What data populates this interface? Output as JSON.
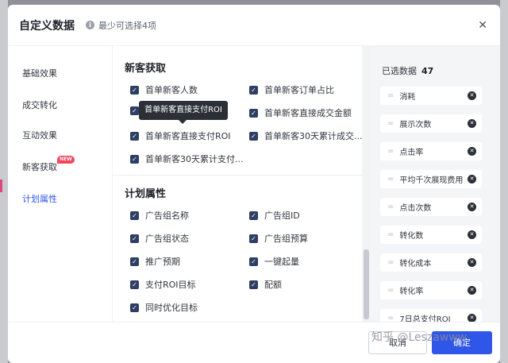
{
  "modal": {
    "title": "自定义数据",
    "hint": "最少可选择4项"
  },
  "sidebar": {
    "items": [
      {
        "label": "基础效果"
      },
      {
        "label": "成交转化"
      },
      {
        "label": "互动效果"
      },
      {
        "label": "新客获取",
        "badge": "NEW"
      },
      {
        "label": "计划属性"
      }
    ],
    "active": "计划属性"
  },
  "sections": [
    {
      "title": "新客获取",
      "options": [
        {
          "label": "首单新客人数",
          "checked": true
        },
        {
          "label": "首单新客订单占比",
          "checked": true
        },
        {
          "label": "",
          "checked": true
        },
        {
          "label": "首单新客直接成交金额",
          "checked": true
        },
        {
          "label": "首单新客直接支付ROI",
          "checked": true
        },
        {
          "label": "首单新客30天累计成交...",
          "checked": true
        },
        {
          "label": "首单新客30天累计支付...",
          "checked": true
        }
      ]
    },
    {
      "title": "计划属性",
      "options": [
        {
          "label": "广告组名称",
          "checked": true
        },
        {
          "label": "广告组ID",
          "checked": true
        },
        {
          "label": "广告组状态",
          "checked": true
        },
        {
          "label": "广告组预算",
          "checked": true
        },
        {
          "label": "推广预期",
          "checked": true
        },
        {
          "label": "一键起量",
          "checked": true
        },
        {
          "label": "支付ROI目标",
          "checked": true
        },
        {
          "label": "配额",
          "checked": true
        },
        {
          "label": "同时优化目标",
          "checked": true
        }
      ]
    }
  ],
  "tooltip": "首单新客直接支付ROI",
  "selected": {
    "title": "已选数据",
    "count": "47",
    "items": [
      "消耗",
      "展示次数",
      "点击率",
      "平均千次展现费用",
      "点击次数",
      "转化数",
      "转化成本",
      "转化率",
      "7日总支付ROI"
    ]
  },
  "footer": {
    "cancel_label": "取消",
    "ok_label": "确定"
  },
  "watermark": "知乎 @Leszawww",
  "colors": {
    "primary": "#2f56e8",
    "checkbox": "#2e3f63",
    "new_badge": "#f5455c"
  },
  "icons": {
    "info": "info-icon",
    "close": "close-icon",
    "drag": "drag-handle-icon",
    "remove": "remove-icon",
    "check": "check-icon"
  }
}
